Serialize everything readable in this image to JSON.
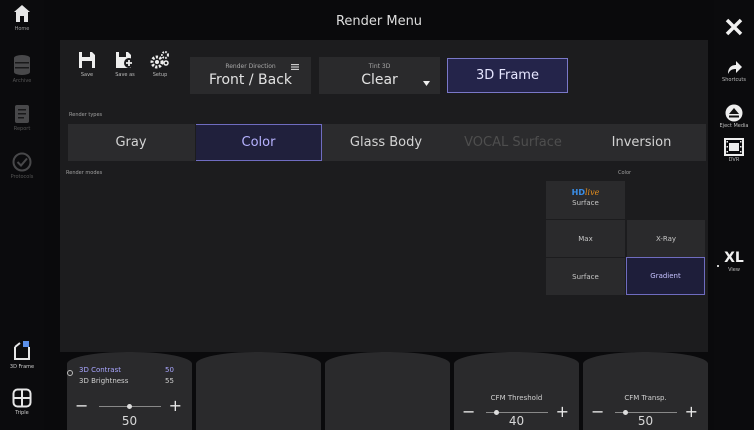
{
  "title": "Render Menu",
  "left_sidebar": {
    "home": "Home",
    "archive": "Archive",
    "report": "Report",
    "protocols": "Protocols",
    "frame3d": "3D Frame",
    "triple": "Triple"
  },
  "right_sidebar": {
    "shortcuts": "Shortcuts",
    "eject": "Eject Media",
    "dvr": "DVR",
    "xl_label": "XL",
    "xl_view": "View"
  },
  "toolbar": {
    "save": "Save",
    "save_as": "Save as",
    "setup": "Setup",
    "render_direction_label": "Render Direction",
    "render_direction_value": "Front / Back",
    "tint_label": "Tint 3D",
    "tint_value": "Clear",
    "frame_3d": "3D Frame"
  },
  "render_types": {
    "label": "Render types",
    "items": [
      "Gray",
      "Color",
      "Glass Body",
      "VOCAL Surface",
      "Inversion"
    ],
    "selected": "Color"
  },
  "render_modes": {
    "label": "Render modes",
    "color_label": "Color",
    "hd": "HD",
    "live": "live",
    "surface_top": "Surface",
    "max": "Max",
    "xray": "X-Ray",
    "surface": "Surface",
    "gradient": "Gradient"
  },
  "knobs": {
    "k1": {
      "line1": "3D Contrast",
      "line1_val": "50",
      "line2": "3D Brightness",
      "line2_val": "55",
      "value": "50"
    },
    "k5": {
      "label": "CFM Threshold",
      "value": "40"
    },
    "k6": {
      "label": "CFM Transp.",
      "value": "50"
    },
    "minus": "−",
    "plus": "+"
  },
  "colors": {
    "accent": "#6f6cc0",
    "hdlive_blue": "#3a8ee8",
    "hdlive_orange": "#e8901e"
  }
}
